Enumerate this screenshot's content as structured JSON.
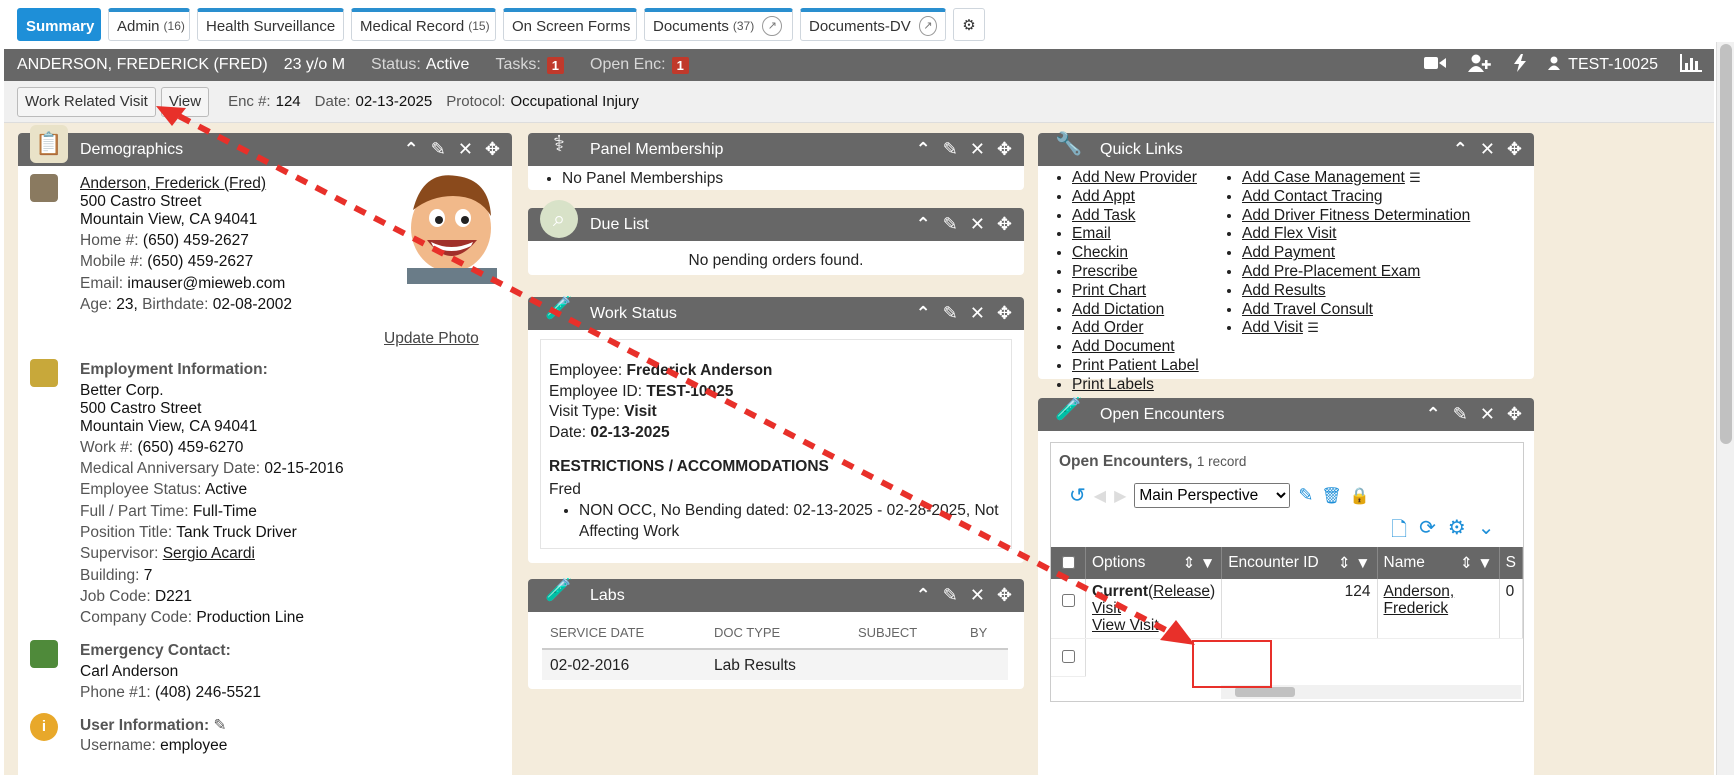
{
  "tabs": [
    {
      "label": "Summary",
      "count": ""
    },
    {
      "label": "Admin",
      "count": "(16)"
    },
    {
      "label": "Health Surveillance",
      "count": ""
    },
    {
      "label": "Medical Record",
      "count": "(15)"
    },
    {
      "label": "On Screen Forms",
      "count": ""
    },
    {
      "label": "Documents",
      "count": "(37)"
    },
    {
      "label": "Documents-DV",
      "count": ""
    }
  ],
  "patient": {
    "name": "ANDERSON, FREDERICK (FRED)",
    "age": "23 y/o M",
    "status_label": "Status:",
    "status_value": "Active",
    "tasks_label": "Tasks:",
    "tasks_count": "1",
    "open_enc_label": "Open Enc:",
    "open_enc_count": "1",
    "id": "TEST-10025"
  },
  "encounter": {
    "visit_button": "Work Related Visit",
    "view_button": "View",
    "enc_label": "Enc #:",
    "enc_value": "124",
    "date_label": "Date:",
    "date_value": "02-13-2025",
    "protocol_label": "Protocol:",
    "protocol_value": "Occupational Injury"
  },
  "demographics": {
    "title": "Demographics",
    "name_link": "Anderson, Frederick (Fred)",
    "addr1": "500 Castro Street",
    "addr2": "Mountain View, CA 94041",
    "home_label": "Home #:",
    "home": "(650) 459-2627",
    "mobile_label": "Mobile #:",
    "mobile": "(650) 459-2627",
    "email_label": "Email:",
    "email": "imauser@mieweb.com",
    "age_label": "Age:",
    "age": "23,",
    "birth_label": "Birthdate:",
    "birth": "02-08-2002",
    "update_photo": "Update Photo",
    "emp_title": "Employment Information:",
    "company": "Better Corp.",
    "emp_addr1": "500 Castro Street",
    "emp_addr2": "Mountain View, CA 94041",
    "work_label": "Work #:",
    "work": "(650) 459-6270",
    "anniv_label": "Medical Anniversary Date:",
    "anniv": "02-15-2016",
    "estatus_label": "Employee Status:",
    "estatus": "Active",
    "fpt_label": "Full / Part Time:",
    "fpt": "Full-Time",
    "pos_label": "Position Title:",
    "pos": "Tank Truck Driver",
    "sup_label": "Supervisor:",
    "sup": "Sergio Acardi",
    "bld_label": "Building:",
    "bld": "7",
    "job_label": "Job Code:",
    "job": "D221",
    "cc_label": "Company Code:",
    "cc": "Production Line",
    "emerg_title": "Emergency Contact:",
    "emerg_name": "Carl Anderson",
    "phone1_label": "Phone #1:",
    "phone1": "(408) 246-5521",
    "user_title": "User Information:",
    "username_label": "Username:",
    "username": "employee"
  },
  "panel_membership": {
    "title": "Panel Membership",
    "item": "No Panel Memberships"
  },
  "due_list": {
    "title": "Due List",
    "message": "No pending orders found."
  },
  "work_status": {
    "title": "Work Status",
    "employee_label": "Employee:",
    "employee": "Frederick Anderson",
    "empid_label": "Employee ID:",
    "empid": "TEST-10025",
    "vtype_label": "Visit Type:",
    "vtype": "Visit",
    "date_label": "Date:",
    "date": "02-13-2025",
    "restr_title": "RESTRICTIONS / ACCOMMODATIONS",
    "restr_name": "Fred",
    "restr_item": "NON OCC, No Bending dated: 02-13-2025 - 02-28-2025, Not Affecting Work"
  },
  "labs": {
    "title": "Labs",
    "headers": [
      "SERVICE DATE",
      "DOC TYPE",
      "SUBJECT",
      "BY"
    ],
    "row": [
      "02-02-2016",
      "Lab Results",
      "",
      ""
    ]
  },
  "quick_links": {
    "title": "Quick Links",
    "col1": [
      "Add New Provider",
      "Add Appt",
      "Add Task",
      "Email",
      "Checkin",
      "Prescribe",
      "Print Chart",
      "Add Dictation",
      "Add Order",
      "Add Document",
      "Print Patient Label",
      "Print Labels"
    ],
    "col2": [
      "Add Case Management",
      "Add Contact Tracing",
      "Add Driver Fitness Determination",
      "Add Flex Visit",
      "Add Payment",
      "Add Pre-Placement Exam",
      "Add Results",
      "Add Travel Consult",
      "Add Visit"
    ]
  },
  "open_encounters": {
    "title": "Open Encounters",
    "grid_title": "Open Encounters,",
    "record_count": "1 record",
    "perspective": "Main Perspective",
    "headers": [
      "Options",
      "Encounter ID",
      "Name",
      "S"
    ],
    "row": {
      "current": "Current",
      "release_open": "(",
      "release": "Release",
      "release_close": ")",
      "visit": "Visit",
      "view_visit": "View Visit",
      "enc_id": "124",
      "name_line1": "Anderson,",
      "name_line2": "Frederick",
      "s": "0"
    }
  },
  "colors": {
    "accent": "#1e8fd8",
    "header": "#676767",
    "badge": "#c0392b",
    "arrow": "#e8302a"
  }
}
